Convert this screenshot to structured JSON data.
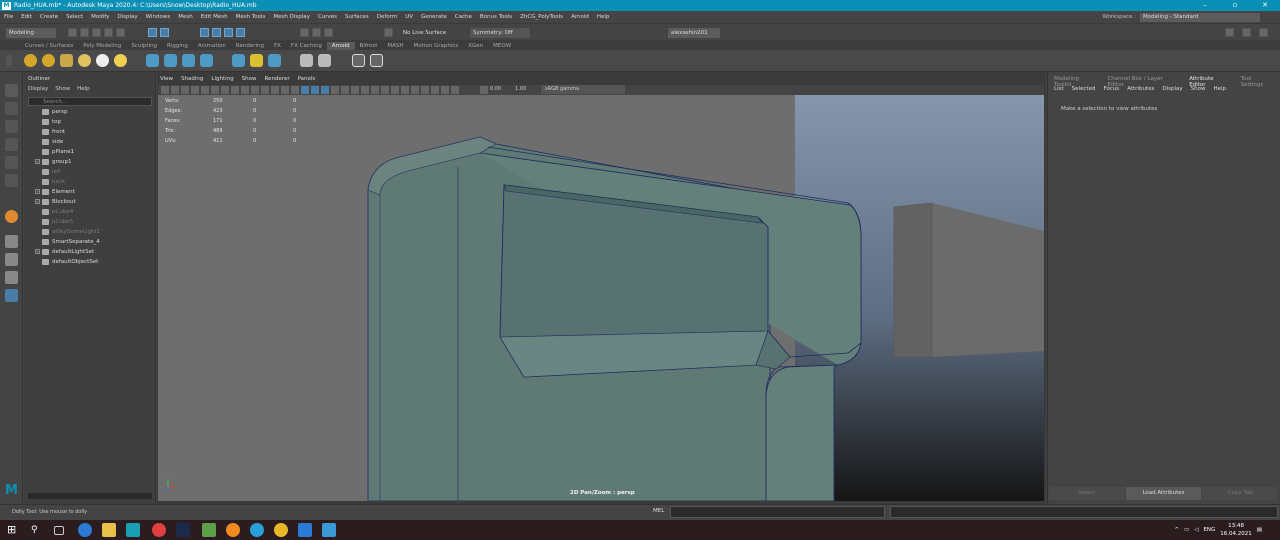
{
  "window": {
    "title": "Radio_HUA.mb* - Autodesk Maya 2020.4: C:\\Users\\Snow\\Desktop\\Radio_HUA.mb"
  },
  "menubar": [
    "File",
    "Edit",
    "Create",
    "Select",
    "Modify",
    "Display",
    "Windows",
    "Mesh",
    "Edit Mesh",
    "Mesh Tools",
    "Mesh Display",
    "Curves",
    "Surfaces",
    "Deform",
    "UV",
    "Generate",
    "Cache",
    "Bonus Tools",
    "ZhCG_PolyTools",
    "Arnold",
    "Help"
  ],
  "workspace": {
    "label": "Workspace :",
    "value": "Modeling - Standard"
  },
  "statusline": {
    "mode": "Modeling",
    "live_surface": "No Live Surface",
    "symmetry": "Symmetry: Off",
    "user": "alexashin201"
  },
  "shelf_tabs": [
    "Curves / Surfaces",
    "Poly Modeling",
    "Sculpting",
    "Rigging",
    "Animation",
    "Rendering",
    "FX",
    "FX Caching",
    "Arnold",
    "Bifrost",
    "MASH",
    "Motion Graphics",
    "XGen",
    "MEOW"
  ],
  "shelf_active": "Arnold",
  "outliner": {
    "title": "Outliner",
    "menu": [
      "Display",
      "Show",
      "Help"
    ],
    "search_placeholder": "Search...",
    "items": [
      {
        "label": "persp",
        "dim": false,
        "expand": false
      },
      {
        "label": "top",
        "dim": false,
        "expand": false
      },
      {
        "label": "front",
        "dim": false,
        "expand": false
      },
      {
        "label": "side",
        "dim": false,
        "expand": false
      },
      {
        "label": "pPlane1",
        "dim": false,
        "expand": false
      },
      {
        "label": "group1",
        "dim": false,
        "expand": true
      },
      {
        "label": "left",
        "dim": true,
        "expand": false
      },
      {
        "label": "back",
        "dim": true,
        "expand": false
      },
      {
        "label": "Element",
        "dim": false,
        "expand": true
      },
      {
        "label": "Blockout",
        "dim": false,
        "expand": true
      },
      {
        "label": "pCube4",
        "dim": true,
        "expand": false
      },
      {
        "label": "pCube5",
        "dim": true,
        "expand": false
      },
      {
        "label": "aiSkyDomeLight1",
        "dim": true,
        "expand": false
      },
      {
        "label": "SmartSeparate_4",
        "dim": false,
        "expand": false
      },
      {
        "label": "defaultLightSet",
        "dim": false,
        "expand": true
      },
      {
        "label": "defaultObjectSet",
        "dim": false,
        "expand": false
      }
    ]
  },
  "viewport": {
    "menu": [
      "View",
      "Shading",
      "Lighting",
      "Show",
      "Renderer",
      "Panels"
    ],
    "exposure": "0.00",
    "gamma": "1.00",
    "colorspace": "sRGB gamma",
    "camera_label": "2D Pan/Zoom : persp",
    "hud": [
      {
        "k": "Verts:",
        "a": "250",
        "b": "0",
        "c": "0"
      },
      {
        "k": "Edges:",
        "a": "423",
        "b": "0",
        "c": "0"
      },
      {
        "k": "Faces:",
        "a": "171",
        "b": "0",
        "c": "0"
      },
      {
        "k": "Tris:",
        "a": "489",
        "b": "0",
        "c": "0"
      },
      {
        "k": "UVs:",
        "a": "411",
        "b": "0",
        "c": "0"
      }
    ]
  },
  "right_panel": {
    "tabs": [
      "Modeling Toolkit",
      "Channel Box / Layer Editor",
      "Attribute Editor",
      "Tool Settings"
    ],
    "active_tab": "Attribute Editor",
    "menu": [
      "List",
      "Selected",
      "Focus",
      "Attributes",
      "Display",
      "Show",
      "Help"
    ],
    "message": "Make a selection to view attributes",
    "buttons": [
      "Select",
      "Load Attributes",
      "Copy Tab"
    ]
  },
  "helpline": {
    "text": "Dolly Tool: Use mouse to dolly",
    "mel_label": "MEL"
  },
  "taskbar": {
    "lang": "ENG",
    "time": "13:48",
    "date": "16.04.2021"
  },
  "colors": {
    "accent": "#0b8fb5",
    "mesh": "#5f7975",
    "bg": "#444444"
  }
}
